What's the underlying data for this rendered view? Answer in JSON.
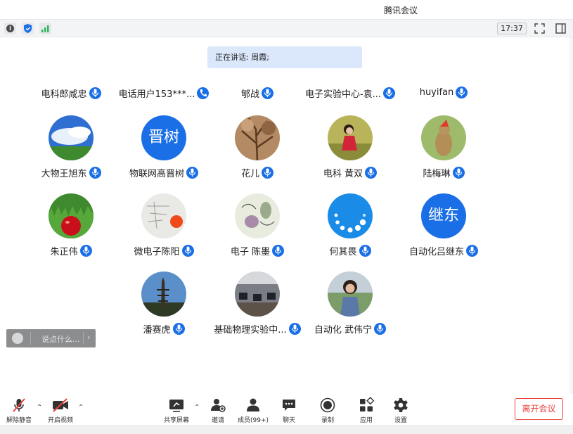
{
  "window": {
    "title": "腾讯会议"
  },
  "infobar": {
    "time": "17:37",
    "icons": [
      "info-icon",
      "shield-icon",
      "signal-icon",
      "fullscreen-icon",
      "sidebar-icon"
    ]
  },
  "speaking": {
    "text": "正在讲话: 周霞;"
  },
  "participants": [
    {
      "name": "电科郎咸忠",
      "avatar": "none"
    },
    {
      "name": "电话用户153***...",
      "avatar": "none",
      "phone": true
    },
    {
      "name": "郇战",
      "avatar": "none"
    },
    {
      "name": "电子实验中心-袁...",
      "avatar": "none"
    },
    {
      "name": "huyifan",
      "avatar": "none"
    },
    {
      "name": "大物王旭东",
      "avatar": "sky-photo"
    },
    {
      "name": "物联网高晋树",
      "avatar": "text",
      "avatar_text": "晋树"
    },
    {
      "name": "花儿",
      "avatar": "tree-photo"
    },
    {
      "name": "电科 黄双",
      "avatar": "child-photo"
    },
    {
      "name": "陆梅琳",
      "avatar": "squirrel-photo"
    },
    {
      "name": "朱正伟",
      "avatar": "apple-photo"
    },
    {
      "name": "微电子陈阳",
      "avatar": "sketch-photo"
    },
    {
      "name": "电子 陈墨",
      "avatar": "drawing-photo"
    },
    {
      "name": "何其畏",
      "avatar": "loading-spinner"
    },
    {
      "name": "自动化吕继东",
      "avatar": "text",
      "avatar_text": "继东"
    },
    {
      "name": "潘赛虎",
      "avatar": "pagoda-photo"
    },
    {
      "name": "基础物理实验中...",
      "avatar": "office-photo"
    },
    {
      "name": "自动化 武伟宁",
      "avatar": "woman-photo"
    }
  ],
  "chat": {
    "placeholder": "说点什么..."
  },
  "toolbar": {
    "unmute": "解除静音",
    "video": "开启视频",
    "share": "共享屏幕",
    "invite": "邀请",
    "members": "成员(99+)",
    "chat": "聊天",
    "record": "录制",
    "apps": "应用",
    "settings": "设置",
    "leave": "离开会议"
  },
  "colors": {
    "accent": "#1a6fe6",
    "danger": "#e8403a",
    "speaking_bg": "#dbe8fb"
  }
}
